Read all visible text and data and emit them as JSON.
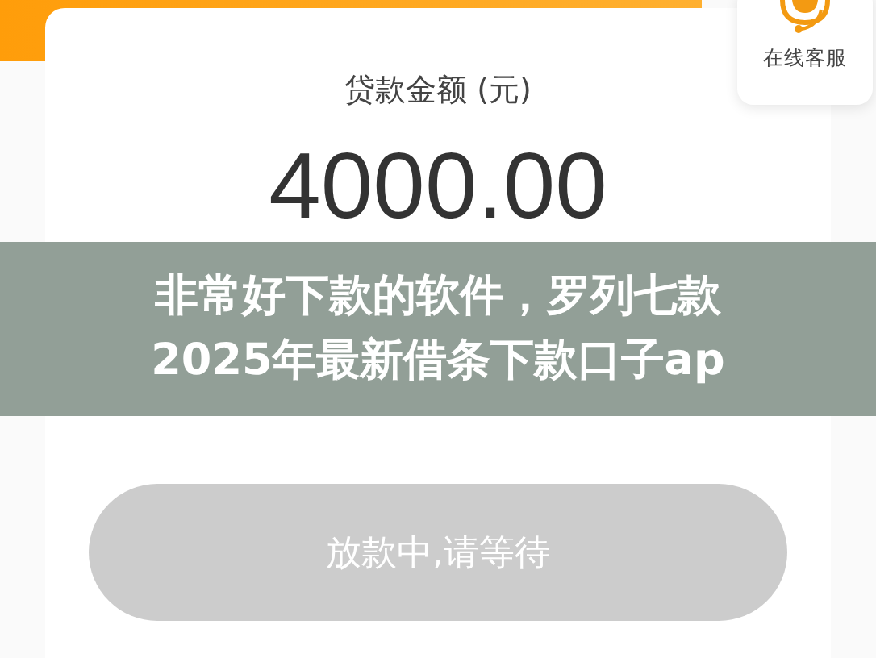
{
  "customer_service": {
    "label": "在线客服"
  },
  "loan": {
    "label": "贷款金额 (元)",
    "amount": "4000.00"
  },
  "banner": {
    "lines": [
      "非常好下款的软件，罗列七款",
      "2025年最新借条下款口子ap"
    ]
  },
  "action_button": {
    "label": "放款中,请等待",
    "disabled": true
  }
}
